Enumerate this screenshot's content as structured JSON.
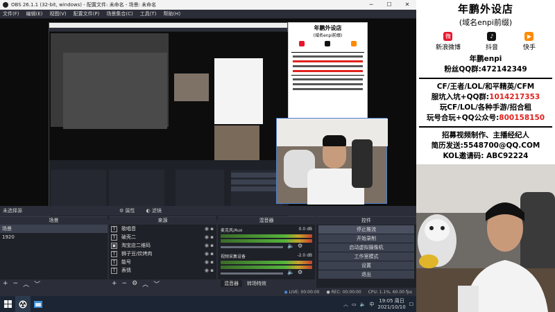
{
  "window": {
    "title": "OBS 26.1.1 (32-bit, windows) - 配置文件: 未命名 - 场景: 未命名",
    "min": "─",
    "max": "☐",
    "close": "✕"
  },
  "menu": [
    "文件(F)",
    "编辑(E)",
    "视图(V)",
    "配置文件(P)",
    "场景集合(C)",
    "工具(T)",
    "帮助(H)"
  ],
  "status_line": {
    "no_source": "未选择源",
    "properties": "属性",
    "filters": "滤镜"
  },
  "docks": {
    "scenes": {
      "header": "场景",
      "items": [
        "场景",
        "1920"
      ]
    },
    "sources": {
      "header": "来源",
      "items": [
        "歌唱音",
        "破壳二",
        "淘宝店二维码",
        "狮子豆/炊烤肉",
        "能号",
        "表情"
      ]
    },
    "mixer": {
      "header": "混音器",
      "channels": [
        {
          "name": "麦克风/Aux",
          "db": "0.0 dB"
        },
        {
          "name": "视频采集设备",
          "db": "-2.0 dB"
        }
      ],
      "tabs": [
        "混音器",
        "转场特效"
      ]
    },
    "controls": {
      "header": "控件",
      "buttons": [
        "停止推流",
        "开始录制",
        "启动虚拟摄像机",
        "工作室模式",
        "设置",
        "退出"
      ]
    }
  },
  "bottom_status": {
    "live": "LIVE: 00:00:00",
    "rec": "REC: 00:00:00",
    "cpu": "CPU: 1.1%, 60.00 fps"
  },
  "taskbar": {
    "time": "19:05 周日",
    "date": "2021/10/10",
    "ime": "中",
    "notification": "☐"
  },
  "banner": {
    "title": "年鹏外设店",
    "subtitle": "(域名enpi前缀)",
    "socials": [
      {
        "label": "新浪微博",
        "color": "#e6162d",
        "icon": "weibo-icon"
      },
      {
        "label": "抖音",
        "color": "#111111",
        "icon": "douyin-icon"
      },
      {
        "label": "快手",
        "color": "#ff8a00",
        "icon": "kuaishou-icon"
      }
    ],
    "account": "年鹏enpi",
    "fans_label": "粉丝QQ群:",
    "fans_qq": "472142349",
    "line1": "CF/王者/LOL/和平精英/CFM",
    "line2_label": "服坑入坑+QQ群:",
    "line2_val": "1014217353",
    "line3": "玩CF/LOL/各种手游/招合租",
    "line4_label": "玩号合玩+QQ公众号:",
    "line4_val": "800158150",
    "line5": "招募视频制作、主播经纪人",
    "line6": "简历发送:5548700@QQ.COM",
    "line7": "KOL邀请码: ABC92224"
  }
}
